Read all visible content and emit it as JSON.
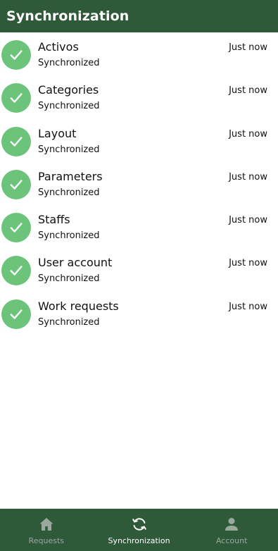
{
  "app_bar": {
    "title": "Synchronization"
  },
  "items": [
    {
      "name": "Activos",
      "status": "Synchronized",
      "time": "Just now"
    },
    {
      "name": "Categories",
      "status": "Synchronized",
      "time": "Just now"
    },
    {
      "name": "Layout",
      "status": "Synchronized",
      "time": "Just now"
    },
    {
      "name": "Parameters",
      "status": "Synchronized",
      "time": "Just now"
    },
    {
      "name": "Staffs",
      "status": "Synchronized",
      "time": "Just now"
    },
    {
      "name": "User account",
      "status": "Synchronized",
      "time": "Just now"
    },
    {
      "name": "Work requests",
      "status": "Synchronized",
      "time": "Just now"
    }
  ],
  "bottom_nav": [
    {
      "label": "Requests",
      "icon": "home-icon",
      "active": false
    },
    {
      "label": "Synchronization",
      "icon": "sync-icon",
      "active": true
    },
    {
      "label": "Account",
      "icon": "person-icon",
      "active": false
    }
  ],
  "colors": {
    "primary": "#2e5a3a",
    "check": "#6cc47b",
    "nav_active": "#ffffff",
    "nav_inactive": "#9aa89e"
  }
}
